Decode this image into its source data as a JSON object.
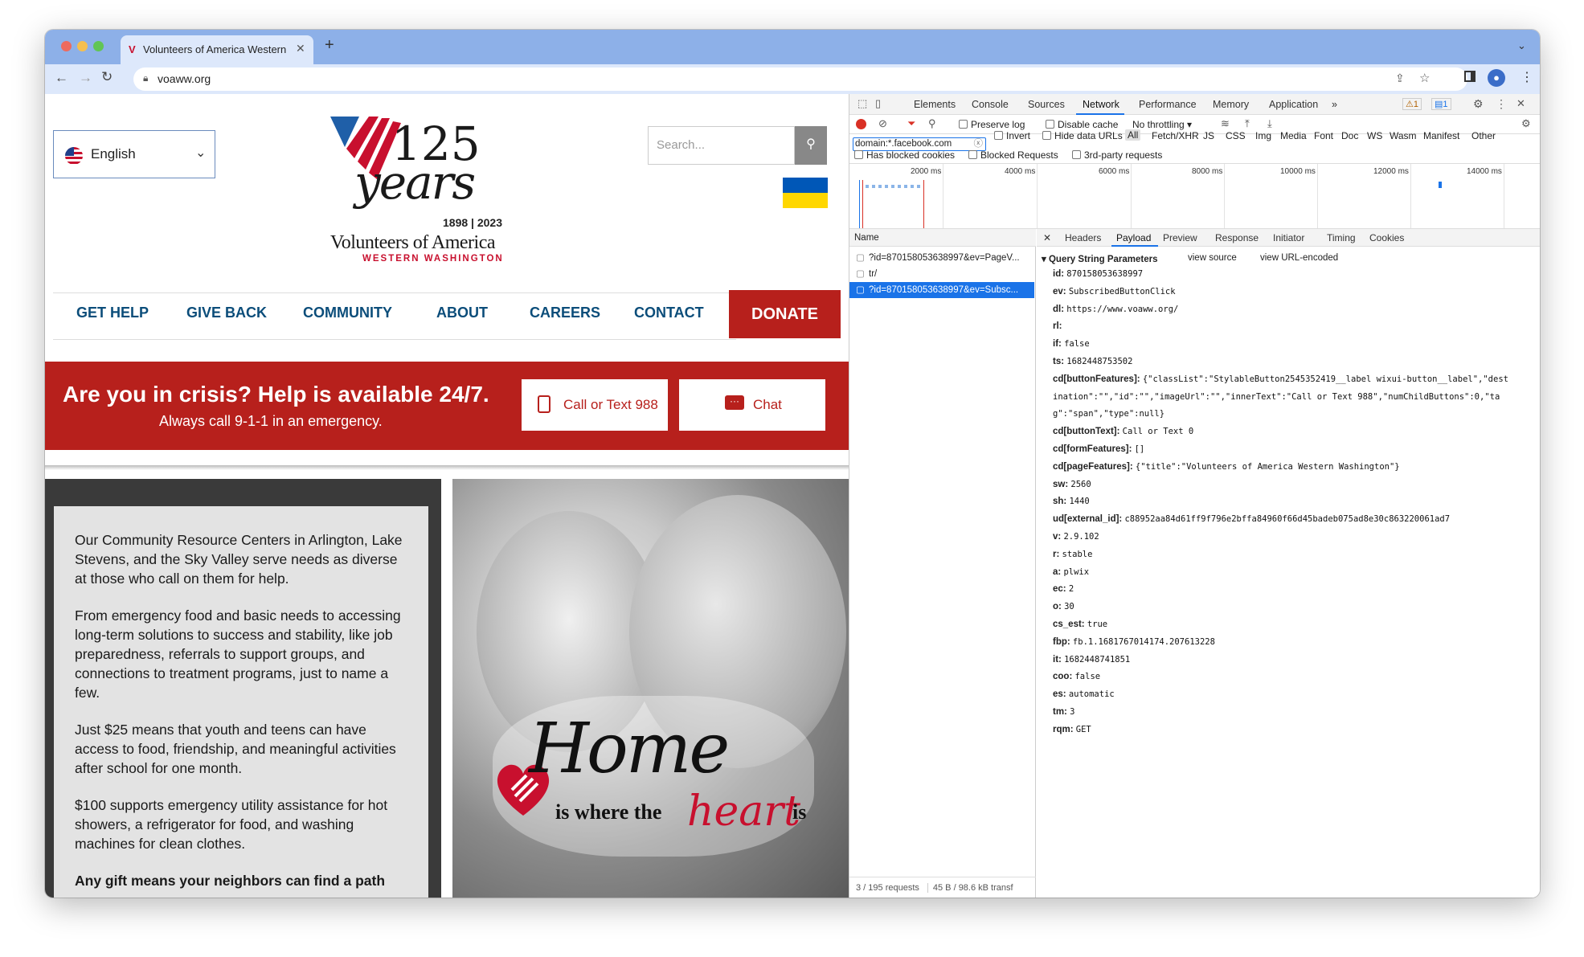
{
  "browser": {
    "tab_title": "Volunteers of America Western Washington",
    "url": "voaww.org"
  },
  "site": {
    "language": "English",
    "search_placeholder": "Search...",
    "logo": {
      "number": "125",
      "script": "years",
      "years": "1898 | 2023",
      "org": "Volunteers of America",
      "region": "WESTERN WASHINGTON"
    },
    "nav": [
      "GET HELP",
      "GIVE BACK",
      "COMMUNITY",
      "ABOUT",
      "CAREERS",
      "CONTACT"
    ],
    "donate": "DONATE",
    "crisis": {
      "title": "Are you in crisis? Help is available 24/7.",
      "subtitle": "Always call 9-1-1 in an emergency.",
      "call_label": "Call or Text 988",
      "chat_label": "Chat"
    },
    "body": {
      "p1": "Our Community Resource Centers in Arlington, Lake Stevens, and the Sky Valley serve needs as diverse at those who call on them for help.",
      "p2": "From emergency food and basic needs to accessing long-term solutions to success and stability, like job preparedness, referrals to support groups, and connections to treatment programs, just to name a few.",
      "p3": "Just $25 means that youth and teens can have access to food, friendship, and meaningful activities after school for one month.",
      "p4": "$100 supports emergency utility assistance for hot showers, a refrigerator for food, and washing machines for clean clothes.",
      "p5": "Any gift means your neighbors can find a path"
    },
    "promo": {
      "home": "Home",
      "tagline_a": "is where the",
      "heart": "heart",
      "tagline_b": "is"
    }
  },
  "devtools": {
    "tabs": [
      "Elements",
      "Console",
      "Sources",
      "Network",
      "Performance",
      "Memory",
      "Application"
    ],
    "active_tab": "Network",
    "badges": {
      "warnings": "1",
      "messages": "1"
    },
    "network_toolbar": {
      "preserve_log": "Preserve log",
      "disable_cache": "Disable cache",
      "throttling": "No throttling"
    },
    "filter": {
      "value": "domain:*.facebook.com",
      "invert": "Invert",
      "hide_data_urls": "Hide data URLs",
      "types": [
        "All",
        "Fetch/XHR",
        "JS",
        "CSS",
        "Img",
        "Media",
        "Font",
        "Doc",
        "WS",
        "Wasm",
        "Manifest",
        "Other"
      ],
      "blocked_cookies": "Has blocked cookies",
      "blocked_requests": "Blocked Requests",
      "third_party": "3rd-party requests"
    },
    "timeline_ticks": [
      "2000 ms",
      "4000 ms",
      "6000 ms",
      "8000 ms",
      "10000 ms",
      "12000 ms",
      "14000 ms"
    ],
    "name_header": "Name",
    "requests": [
      "?id=870158053638997&ev=PageV...",
      "tr/",
      "?id=870158053638997&ev=Subsc..."
    ],
    "detail_tabs": [
      "Headers",
      "Payload",
      "Preview",
      "Response",
      "Initiator",
      "Timing",
      "Cookies"
    ],
    "active_detail_tab": "Payload",
    "section_title": "Query String Parameters",
    "view_source": "view source",
    "view_url_encoded": "view URL-encoded",
    "params": [
      {
        "k": "id:",
        "v": "870158053638997"
      },
      {
        "k": "ev:",
        "v": "SubscribedButtonClick"
      },
      {
        "k": "dl:",
        "v": "https://www.voaww.org/"
      },
      {
        "k": "rl:",
        "v": ""
      },
      {
        "k": "if:",
        "v": "false"
      },
      {
        "k": "ts:",
        "v": "1682448753502"
      },
      {
        "k": "cd[buttonFeatures]:",
        "v": "{\"classList\":\"StylableButton2545352419__label wixui-button__label\",\"dest"
      },
      {
        "k": "",
        "v": "ination\":\"\",\"id\":\"\",\"imageUrl\":\"\",\"innerText\":\"Call or Text 988\",\"numChildButtons\":0,\"ta"
      },
      {
        "k": "",
        "v": "g\":\"span\",\"type\":null}"
      },
      {
        "k": "cd[buttonText]:",
        "v": "Call or Text 0"
      },
      {
        "k": "cd[formFeatures]:",
        "v": "[]"
      },
      {
        "k": "cd[pageFeatures]:",
        "v": "{\"title\":\"Volunteers of America Western Washington\"}"
      },
      {
        "k": "sw:",
        "v": "2560"
      },
      {
        "k": "sh:",
        "v": "1440"
      },
      {
        "k": "ud[external_id]:",
        "v": "c88952aa84d61ff9f796e2bffa84960f66d45badeb075ad8e30c863220061ad7"
      },
      {
        "k": "v:",
        "v": "2.9.102"
      },
      {
        "k": "r:",
        "v": "stable"
      },
      {
        "k": "a:",
        "v": "plwix"
      },
      {
        "k": "ec:",
        "v": "2"
      },
      {
        "k": "o:",
        "v": "30"
      },
      {
        "k": "cs_est:",
        "v": "true"
      },
      {
        "k": "fbp:",
        "v": "fb.1.1681767014174.207613228"
      },
      {
        "k": "it:",
        "v": "1682448741851"
      },
      {
        "k": "coo:",
        "v": "false"
      },
      {
        "k": "es:",
        "v": "automatic"
      },
      {
        "k": "tm:",
        "v": "3"
      },
      {
        "k": "rqm:",
        "v": "GET"
      }
    ],
    "status": {
      "requests": "3 / 195 requests",
      "transferred": "45 B / 98.6 kB transf"
    }
  }
}
